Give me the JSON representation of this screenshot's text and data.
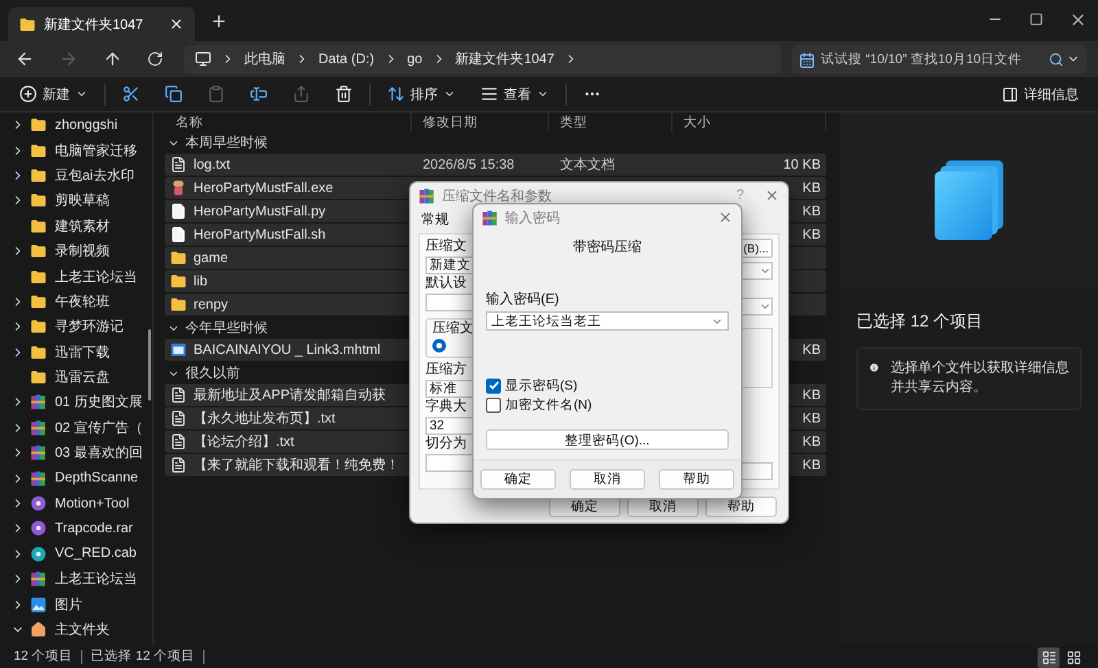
{
  "window": {
    "tab_title": "新建文件夹1047"
  },
  "nav": [
    {
      "kind": "back",
      "disabled": false
    },
    {
      "kind": "forward",
      "disabled": true
    },
    {
      "kind": "up",
      "disabled": false
    },
    {
      "kind": "refresh",
      "disabled": false
    }
  ],
  "address": {
    "segments": [
      "此电脑",
      "Data (D:)",
      "go",
      "新建文件夹1047"
    ]
  },
  "search": {
    "placeholder": "试试搜 “10/10” 查找10月10日文件"
  },
  "toolbar": {
    "items": [
      {
        "kind": "new",
        "label": "新建",
        "disabled": false
      },
      {
        "kind": "cut",
        "disabled": false
      },
      {
        "kind": "copy",
        "disabled": false
      },
      {
        "kind": "paste",
        "disabled": true
      },
      {
        "kind": "rename",
        "disabled": false
      },
      {
        "kind": "share",
        "disabled": true
      },
      {
        "kind": "delete",
        "disabled": false
      },
      {
        "kind": "sort",
        "label": "排序",
        "disabled": false
      },
      {
        "kind": "view",
        "label": "查看",
        "disabled": false
      },
      {
        "kind": "more",
        "disabled": false
      }
    ],
    "details_label": "详细信息"
  },
  "sidebar": {
    "items": [
      {
        "name": "zhonggshi",
        "kind": "folder",
        "expandable": true,
        "expanded": false
      },
      {
        "name": "电脑管家迁移",
        "kind": "folder",
        "expandable": true,
        "expanded": false
      },
      {
        "name": "豆包ai去水印",
        "kind": "folder",
        "expandable": true,
        "expanded": false
      },
      {
        "name": "剪映草稿",
        "kind": "folder",
        "expandable": true,
        "expanded": false
      },
      {
        "name": "建筑素材",
        "kind": "folder",
        "expandable": false
      },
      {
        "name": "录制视频",
        "kind": "folder",
        "expandable": true,
        "expanded": false
      },
      {
        "name": "上老王论坛当",
        "kind": "folder",
        "expandable": false
      },
      {
        "name": "午夜轮班",
        "kind": "folder",
        "expandable": true,
        "expanded": false
      },
      {
        "name": "寻梦环游记",
        "kind": "folder",
        "expandable": true,
        "expanded": false
      },
      {
        "name": "迅雷下载",
        "kind": "folder",
        "expandable": true,
        "expanded": false
      },
      {
        "name": "迅雷云盘",
        "kind": "folder",
        "expandable": false
      },
      {
        "name": "01 历史图文展",
        "kind": "archive",
        "expandable": true,
        "expanded": false
      },
      {
        "name": "02 宣传广告（",
        "kind": "archive",
        "expandable": true,
        "expanded": false
      },
      {
        "name": "03 最喜欢的回",
        "kind": "archive",
        "expandable": true,
        "expanded": false
      },
      {
        "name": "DepthScanne",
        "kind": "archive",
        "expandable": true,
        "expanded": false
      },
      {
        "name": "Motion+Tool",
        "kind": "installer",
        "expandable": true,
        "expanded": false
      },
      {
        "name": "Trapcode.rar",
        "kind": "installer",
        "expandable": true,
        "expanded": false
      },
      {
        "name": "VC_RED.cab",
        "kind": "cabinet",
        "expandable": true,
        "expanded": false
      },
      {
        "name": "上老王论坛当",
        "kind": "archive",
        "expandable": true,
        "expanded": false
      },
      {
        "name": "图片",
        "kind": "pictures",
        "expandable": true,
        "expanded": false
      },
      {
        "name": "主文件夹",
        "kind": "home",
        "expandable": true,
        "expanded": true
      }
    ]
  },
  "columns": [
    "名称",
    "修改日期",
    "类型",
    "大小"
  ],
  "groups": [
    {
      "title": "本周早些时候",
      "expanded": true,
      "files": [
        {
          "name": "log.txt",
          "kind": "text",
          "date": "2026/8/5 15:38",
          "type": "文本文档",
          "size": "10 KB",
          "selected": true
        },
        {
          "name": "HeroPartyMustFall.exe",
          "kind": "exe",
          "size": "KB",
          "selected": true
        },
        {
          "name": "HeroPartyMustFall.py",
          "kind": "script",
          "size": "KB",
          "selected": true
        },
        {
          "name": "HeroPartyMustFall.sh",
          "kind": "script",
          "size": "KB",
          "selected": true
        },
        {
          "name": "game",
          "kind": "folder",
          "selected": true
        },
        {
          "name": "lib",
          "kind": "folder",
          "selected": true
        },
        {
          "name": "renpy",
          "kind": "folder",
          "selected": true
        }
      ]
    },
    {
      "title": "今年早些时候",
      "expanded": true,
      "files": [
        {
          "name": "BAICAINAIYOU _ Link3.mhtml",
          "kind": "webpage",
          "size": "KB",
          "selected": true
        }
      ]
    },
    {
      "title": "很久以前",
      "expanded": true,
      "files": [
        {
          "name": "最新地址及APP请发邮箱自动获",
          "kind": "text",
          "size": "KB",
          "selected": true
        },
        {
          "name": "【永久地址发布页】.txt",
          "kind": "text",
          "size": "KB",
          "selected": true
        },
        {
          "name": "【论坛介绍】.txt",
          "kind": "text",
          "size": "KB",
          "selected": true
        },
        {
          "name": "【来了就能下载和观看！纯免费！",
          "kind": "text",
          "size": "KB",
          "selected": true
        }
      ]
    }
  ],
  "right_pane": {
    "title": "已选择 12 个项目",
    "hint": "选择单个文件以获取详细信息并共享云内容。"
  },
  "status_bar": {
    "count": "12 个项目",
    "selected": "已选择 12 个项目",
    "views": [
      {
        "kind": "details",
        "selected": true
      },
      {
        "kind": "tiles",
        "selected": false
      }
    ]
  },
  "archive_dialog": {
    "title": "压缩文件名和参数",
    "help_mark": "?",
    "tab": {
      "label": "常规",
      "selected": true
    },
    "browse_button": "(B)...",
    "name_label": "压缩文",
    "name_value": "新建文",
    "profile_label": "默认设",
    "format_group": "压缩文",
    "format_radio_selected": true,
    "method_label": "压缩方",
    "method_value": "标准",
    "dict_label": "字典大",
    "dict_value": "32",
    "split_label": "切分为",
    "buttons": [
      "确定",
      "取消",
      "帮助"
    ]
  },
  "password_dialog": {
    "title": "输入密码",
    "heading": "带密码压缩",
    "password_label": "输入密码(E)",
    "password_value": "上老王论坛当老王",
    "options": [
      {
        "label": "显示密码(S)",
        "checked": true
      },
      {
        "label": "加密文件名(N)",
        "checked": false
      }
    ],
    "organize_button": "整理密码(O)...",
    "buttons": [
      "确定",
      "取消",
      "帮助"
    ]
  }
}
